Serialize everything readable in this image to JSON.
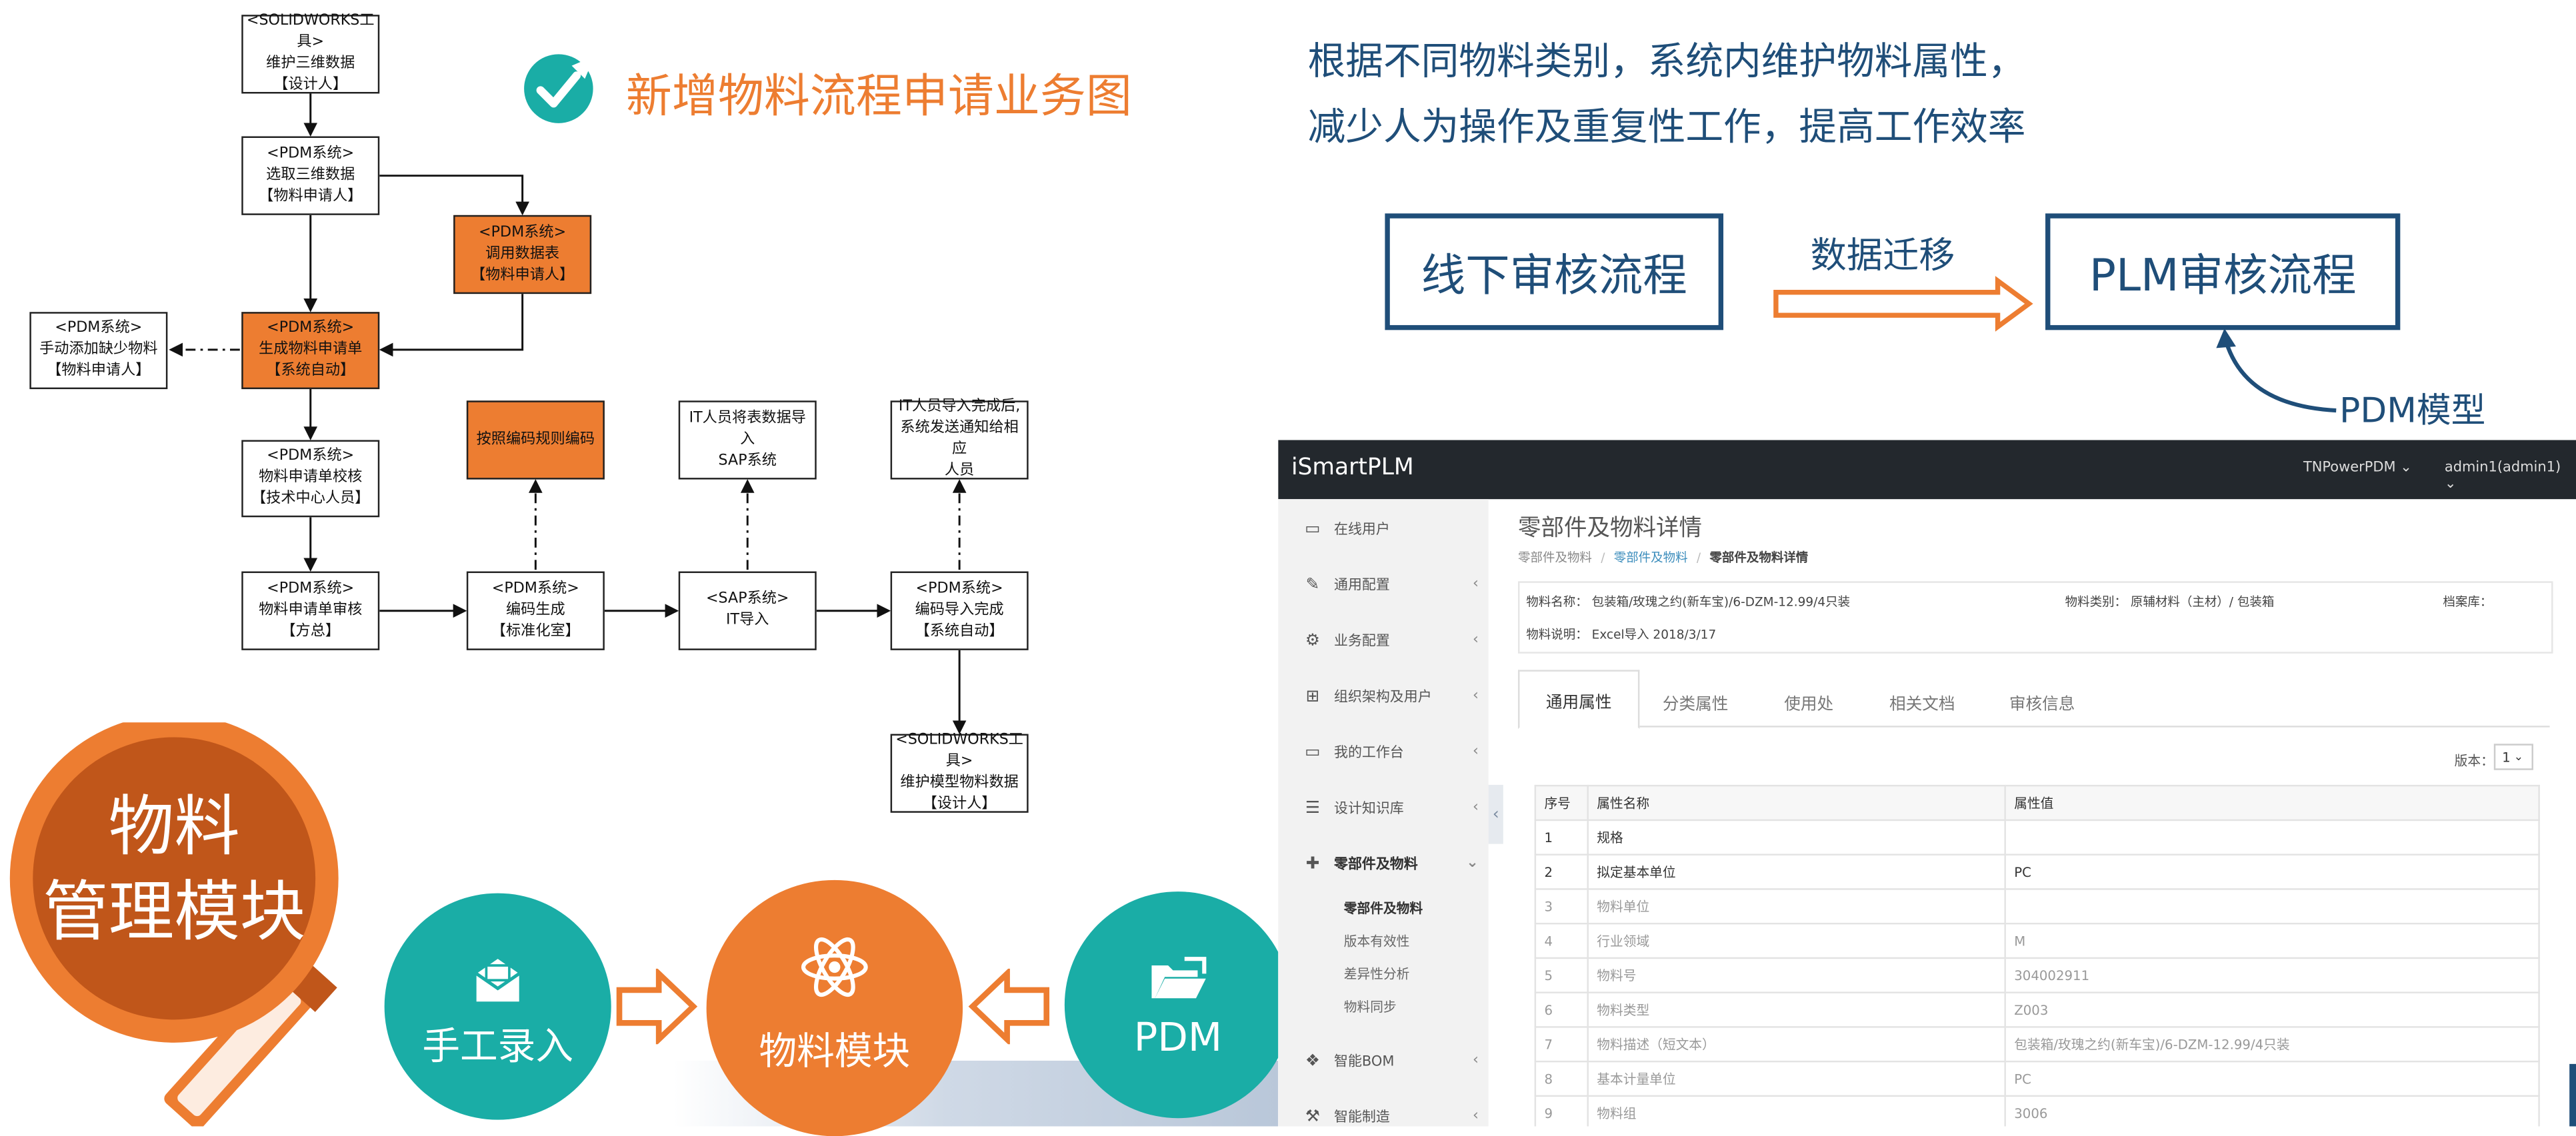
{
  "flow": {
    "title": "新增物料流程申请业务图",
    "colors": {
      "orange": "#ed7d31",
      "border": "#222222"
    },
    "boxes": {
      "b1": [
        "<SOLIDWORKS工具>",
        "维护三维数据",
        "【设计人】"
      ],
      "b2": [
        "<PDM系统>",
        "选取三维数据",
        "【物料申请人】"
      ],
      "b3": [
        "<PDM系统>",
        "调用数据表",
        "【物料申请人】"
      ],
      "b4": [
        "<PDM系统>",
        "生成物料申请单",
        "【系统自动】"
      ],
      "b5": [
        "<PDM系统>",
        "手动添加缺少物料",
        "【物料申请人】"
      ],
      "b6": [
        "<PDM系统>",
        "物料申请单校核",
        "【技术中心人员】"
      ],
      "b7": [
        "按照编码规则编码"
      ],
      "b8": [
        "IT人员将表数据导入",
        "SAP系统"
      ],
      "b9": [
        "IT人员导入完成后,",
        "系统发送通知给相应",
        "人员"
      ],
      "b10": [
        "<PDM系统>",
        "物料申请单审核",
        "【方总】"
      ],
      "b11": [
        "<PDM系统>",
        "编码生成",
        "【标准化室】"
      ],
      "b12": [
        "<SAP系统>",
        "IT导入"
      ],
      "b13": [
        "<PDM系统>",
        "编码导入完成",
        "【系统自动】"
      ],
      "b14": [
        "<SOLIDWORKS工具>",
        "维护模型物料数据",
        "【设计人】"
      ]
    }
  },
  "intro": {
    "line1": "根据不同物料类别，系统内维护物料属性，",
    "line2": "减少人为操作及重复性工作，提高工作效率"
  },
  "migration": {
    "left_box": "线下审核流程",
    "arrow_label": "数据迁移",
    "right_box": "PLM审核流程",
    "model_label": "PDM模型"
  },
  "module": {
    "magnifier_line1": "物料",
    "magnifier_line2": "管理模块",
    "manual": "手工录入",
    "center": "物料模块",
    "pdm": "PDM",
    "colors": {
      "teal": "#1aada6",
      "orange": "#ed7d31",
      "dark_orange": "#c0561a"
    }
  },
  "app": {
    "brand": "iSmartPLM",
    "top_menu": [
      "TNPowerPDM ⌄",
      "admin1(admin1) ⌄"
    ],
    "sidebar": {
      "items": [
        {
          "icon": "id-card-icon",
          "label": "在线用户"
        },
        {
          "icon": "wrench-icon",
          "label": "通用配置"
        },
        {
          "icon": "gears-icon",
          "label": "业务配置"
        },
        {
          "icon": "sitemap-icon",
          "label": "组织架构及用户"
        },
        {
          "icon": "laptop-icon",
          "label": "我的工作台"
        },
        {
          "icon": "list-icon",
          "label": "设计知识库"
        },
        {
          "icon": "puzzle-icon",
          "label": "零部件及物料"
        },
        {
          "icon": "cubes-icon",
          "label": "智能BOM"
        },
        {
          "icon": "tool-icon",
          "label": "智能制造"
        }
      ],
      "sub_items": [
        "零部件及物料",
        "版本有效性",
        "差异性分析",
        "物料同步"
      ]
    },
    "page_title": "零部件及物料详情",
    "breadcrumb": [
      "零部件及物料",
      "零部件及物料",
      "零部件及物料详情"
    ],
    "info": {
      "name_label": "物料名称：",
      "name_value": "包装箱/玫瑰之约(新车宝)/6-DZM-12.99/4只装",
      "type_label": "物料类别：",
      "type_value": "原辅材料（主材）/ 包装箱",
      "archive_label": "档案库：",
      "desc_label": "物料说明：",
      "desc_value": "Excel导入 2018/3/17"
    },
    "tabs": [
      "通用属性",
      "分类属性",
      "使用处",
      "相关文档",
      "审核信息"
    ],
    "version_label": "版本：",
    "version_value": "1",
    "table": {
      "headers": [
        "序号",
        "属性名称",
        "属性值"
      ],
      "rows": [
        [
          "1",
          "规格",
          ""
        ],
        [
          "2",
          "拟定基本单位",
          "PC"
        ],
        [
          "3",
          "物料单位",
          ""
        ],
        [
          "4",
          "行业领域",
          "M"
        ],
        [
          "5",
          "物料号",
          "304002911"
        ],
        [
          "6",
          "物料类型",
          "Z003"
        ],
        [
          "7",
          "物料描述（短文本）",
          "包装箱/玫瑰之约(新车宝)/6-DZM-12.99/4只装"
        ],
        [
          "8",
          "基本计量单位",
          "PC"
        ],
        [
          "9",
          "物料组",
          "3006"
        ]
      ]
    }
  }
}
